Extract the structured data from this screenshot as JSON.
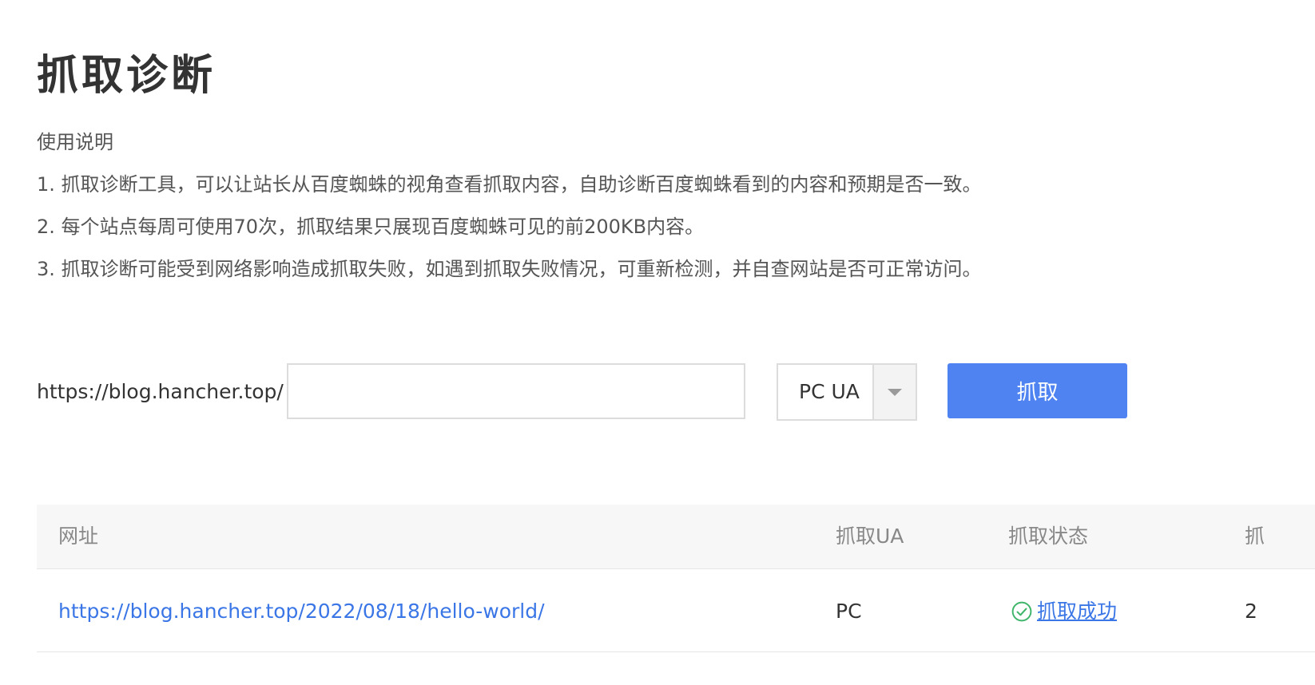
{
  "page": {
    "title": "抓取诊断"
  },
  "instructions": {
    "heading": "使用说明",
    "items": [
      "1. 抓取诊断工具，可以让站长从百度蜘蛛的视角查看抓取内容，自助诊断百度蜘蛛看到的内容和预期是否一致。",
      "2. 每个站点每周可使用70次，抓取结果只展现百度蜘蛛可见的前200KB内容。",
      "3. 抓取诊断可能受到网络影响造成抓取失败，如遇到抓取失败情况，可重新检测，并自查网站是否可正常访问。"
    ]
  },
  "form": {
    "url_prefix": "https://blog.hancher.top/",
    "url_input_value": "",
    "ua_select_value": "PC UA",
    "submit_label": "抓取"
  },
  "table": {
    "columns": [
      "网址",
      "抓取UA",
      "抓取状态",
      "抓"
    ],
    "rows": [
      {
        "url": "https://blog.hancher.top/2022/08/18/hello-world/",
        "ua": "PC",
        "status": "抓取成功",
        "time": "2"
      }
    ]
  },
  "colors": {
    "primary": "#4e83f1",
    "link": "#3a76e6",
    "success_icon": "#3fb56b",
    "header_bg": "#f7f7f7",
    "border": "#dcdcdc"
  },
  "icons": {
    "dropdown": "chevron-down-icon",
    "status_success": "check-circle-icon"
  }
}
